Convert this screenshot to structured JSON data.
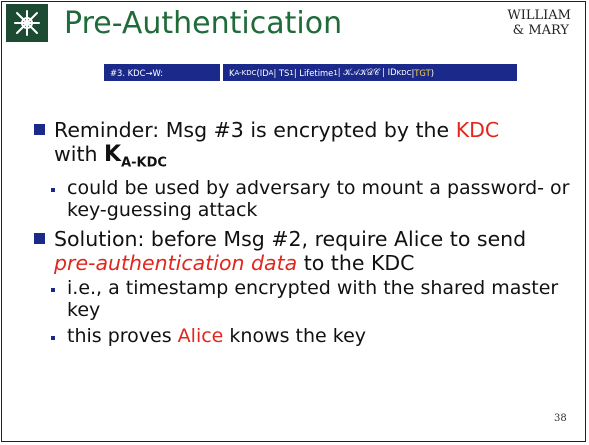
{
  "slide": {
    "title": "Pre-Authentication",
    "watermark_line1": "WILLIAM",
    "watermark_line2": "& MARY",
    "page_number": "38"
  },
  "ribbon": {
    "left": "#3. KDC→W:",
    "right_prefix": "K",
    "right_sub": "A-KDC",
    "right_rest": "(ID",
    "right_sub2": "A",
    "right_mid": " | TS",
    "right_sub3": "1",
    "right_mid2": " | Lifetime",
    "right_sub4": "1",
    "right_mid3": " | 𝒦𝒜𝒦𝒟𝒞 | ID",
    "right_sub5": "KDC",
    "right_mid4": " | ",
    "right_tgt": "TGT",
    "right_end": ")"
  },
  "bullets": {
    "b1_part1": "Reminder: Msg #3 is encrypted by the ",
    "b1_red": "KDC",
    "b1_part2": "with ",
    "b1_key": "K",
    "b1_key_sub": "A-KDC",
    "s1": "could be used by adversary to mount a password- or key-guessing attack",
    "b2_part1": "Solution: before Msg #2, require Alice to send ",
    "b2_red": "pre-authentication data",
    "b2_part2": " to the KDC",
    "s2": "i.e., a timestamp encrypted with the shared master key",
    "s3_part1": "this proves ",
    "s3_red": "Alice",
    "s3_part2": " knows the key"
  },
  "colors": {
    "title_green": "#1f6b3a",
    "accent_blue": "#1b2a8a",
    "highlight_red": "#e2261d",
    "logo_green": "#1c4a32"
  }
}
